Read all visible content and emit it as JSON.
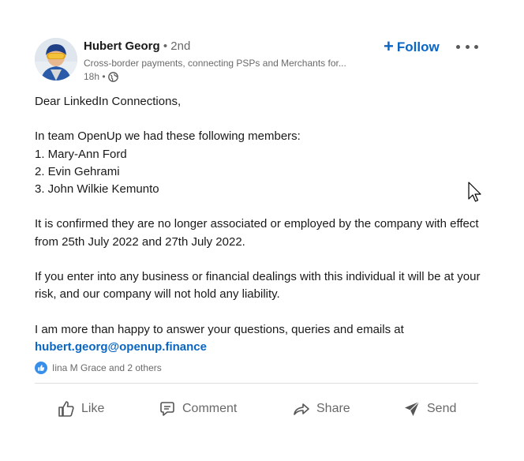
{
  "author": {
    "name": "Hubert Georg",
    "degree": "• 2nd",
    "headline": "Cross-border payments, connecting PSPs and Merchants for...",
    "time": "18h •"
  },
  "header": {
    "follow_label": "Follow",
    "more_icon": "more-horizontal-icon"
  },
  "post": {
    "greeting": "Dear LinkedIn Connections,",
    "intro": "In team OpenUp we had these following members:",
    "members": [
      "1. Mary-Ann Ford",
      "2. Evin Gehrami",
      "3. John Wilkie Kemunto"
    ],
    "confirmation": "It is confirmed they are no longer associated or employed by the company with effect from 25th July 2022 and 27th July 2022.",
    "warning": "If you enter into any business or financial dealings with this individual it will be at your risk, and our company will not hold any liability.",
    "closing": "I am more than happy to answer your questions, queries and emails at",
    "email": "hubert.georg@openup.finance"
  },
  "reactions": {
    "summary": "Iina M Grace and 2 others"
  },
  "actions": {
    "like": "Like",
    "comment": "Comment",
    "share": "Share",
    "send": "Send"
  },
  "colors": {
    "accent": "#0a66c2",
    "like_badge": "#378fe9",
    "secondary_text": "#666666"
  }
}
